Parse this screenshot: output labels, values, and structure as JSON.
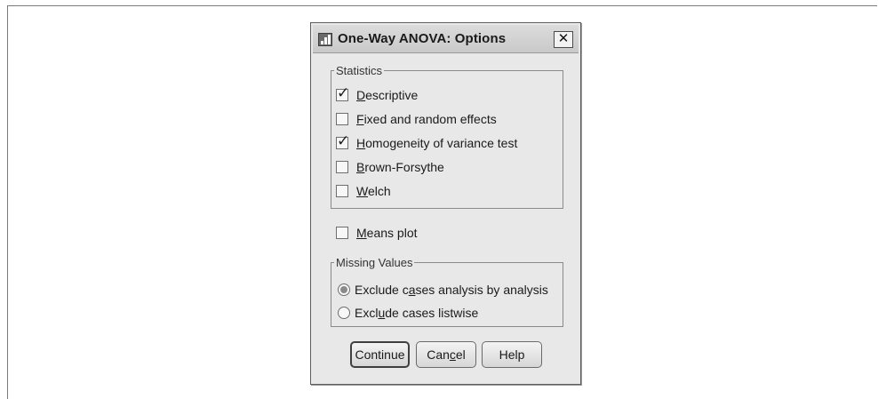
{
  "dialog": {
    "title": "One-Way ANOVA: Options",
    "close_glyph": "✕"
  },
  "statistics": {
    "legend": "Statistics",
    "items": [
      {
        "prefix": "",
        "key": "D",
        "rest": "escriptive",
        "checked": true
      },
      {
        "prefix": "",
        "key": "F",
        "rest": "ixed and random effects",
        "checked": false
      },
      {
        "prefix": "",
        "key": "H",
        "rest": "omogeneity of variance test",
        "checked": true
      },
      {
        "prefix": "",
        "key": "B",
        "rest": "rown-Forsythe",
        "checked": false
      },
      {
        "prefix": "",
        "key": "W",
        "rest": "elch",
        "checked": false
      }
    ]
  },
  "means_plot": {
    "prefix": "",
    "key": "M",
    "rest": "eans plot",
    "checked": false
  },
  "missing_values": {
    "legend": "Missing Values",
    "options": [
      {
        "prefix": "Exclude c",
        "key": "a",
        "rest": "ses analysis by analysis",
        "selected": true
      },
      {
        "prefix": "Excl",
        "key": "u",
        "rest": "de cases listwise",
        "selected": false
      }
    ]
  },
  "buttons": {
    "continue": "Continue",
    "cancel_prefix": "Can",
    "cancel_key": "c",
    "cancel_rest": "el",
    "help": "Help"
  },
  "icons": {
    "app": "spss-chart-icon",
    "close": "close-icon",
    "check": "checkmark-icon"
  },
  "colors": {
    "dialog_bg": "#e8e8e8",
    "titlebar": "#cfcfcf",
    "border": "#5e5e5e"
  }
}
